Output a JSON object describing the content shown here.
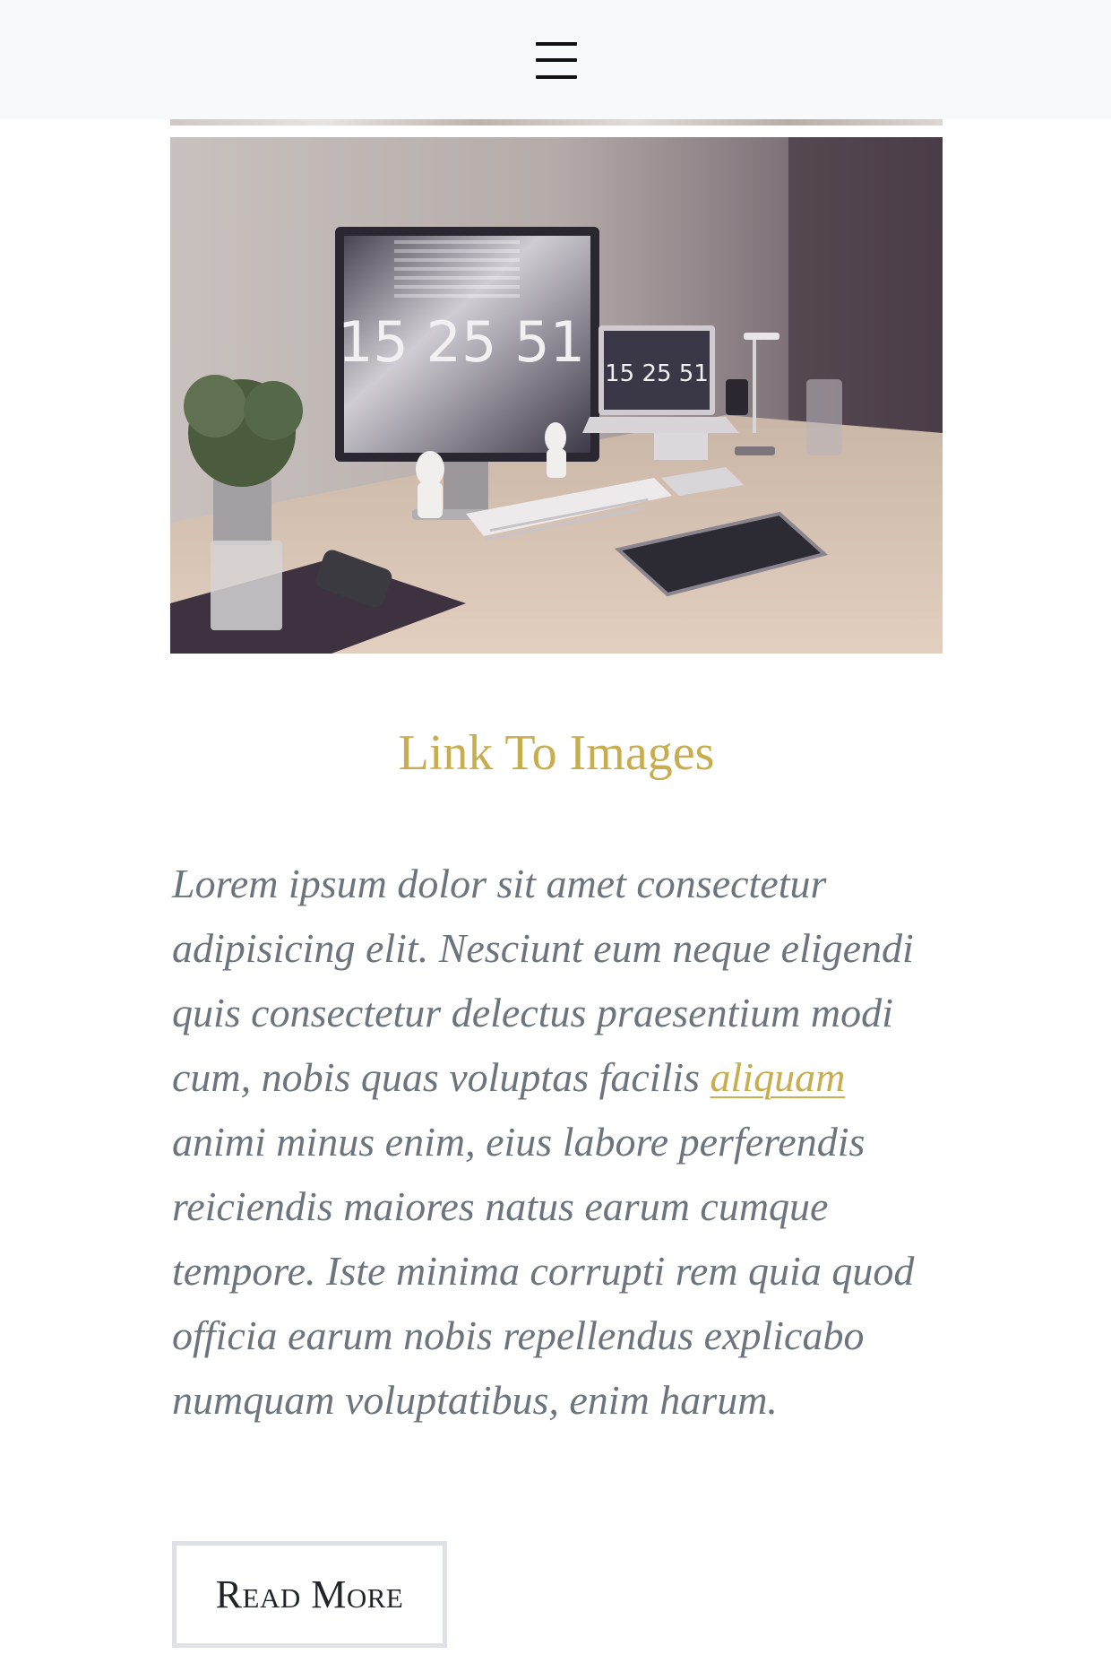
{
  "navbar": {
    "menu_icon": "hamburger-menu-icon",
    "background": "#f8f9fa"
  },
  "post": {
    "image_alt": "Desk workspace with monitor, laptop, keyboard, tablet and plant",
    "monitor_clock": "15 25 51",
    "laptop_clock": "15 25 51",
    "title": "Link To Images",
    "body_before_link": "Lorem ipsum dolor sit amet consectetur adipisicing elit. Nesciunt eum neque eligendi quis consectetur delectus praesentium modi cum, nobis quas voluptas facilis ",
    "body_link": "aliquam",
    "body_after_link": " animi minus enim, eius labore perferendis reiciendis maiores natus earum cumque tempore. Iste minima corrupti rem quia quod officia earum nobis repellendus explicabo numquam voluptatibus, enim harum.",
    "read_more_label": "Read More"
  },
  "colors": {
    "accent": "#c8ad4f",
    "body_text": "#6c757d",
    "button_border": "#dee2e6",
    "button_text": "#212529"
  }
}
